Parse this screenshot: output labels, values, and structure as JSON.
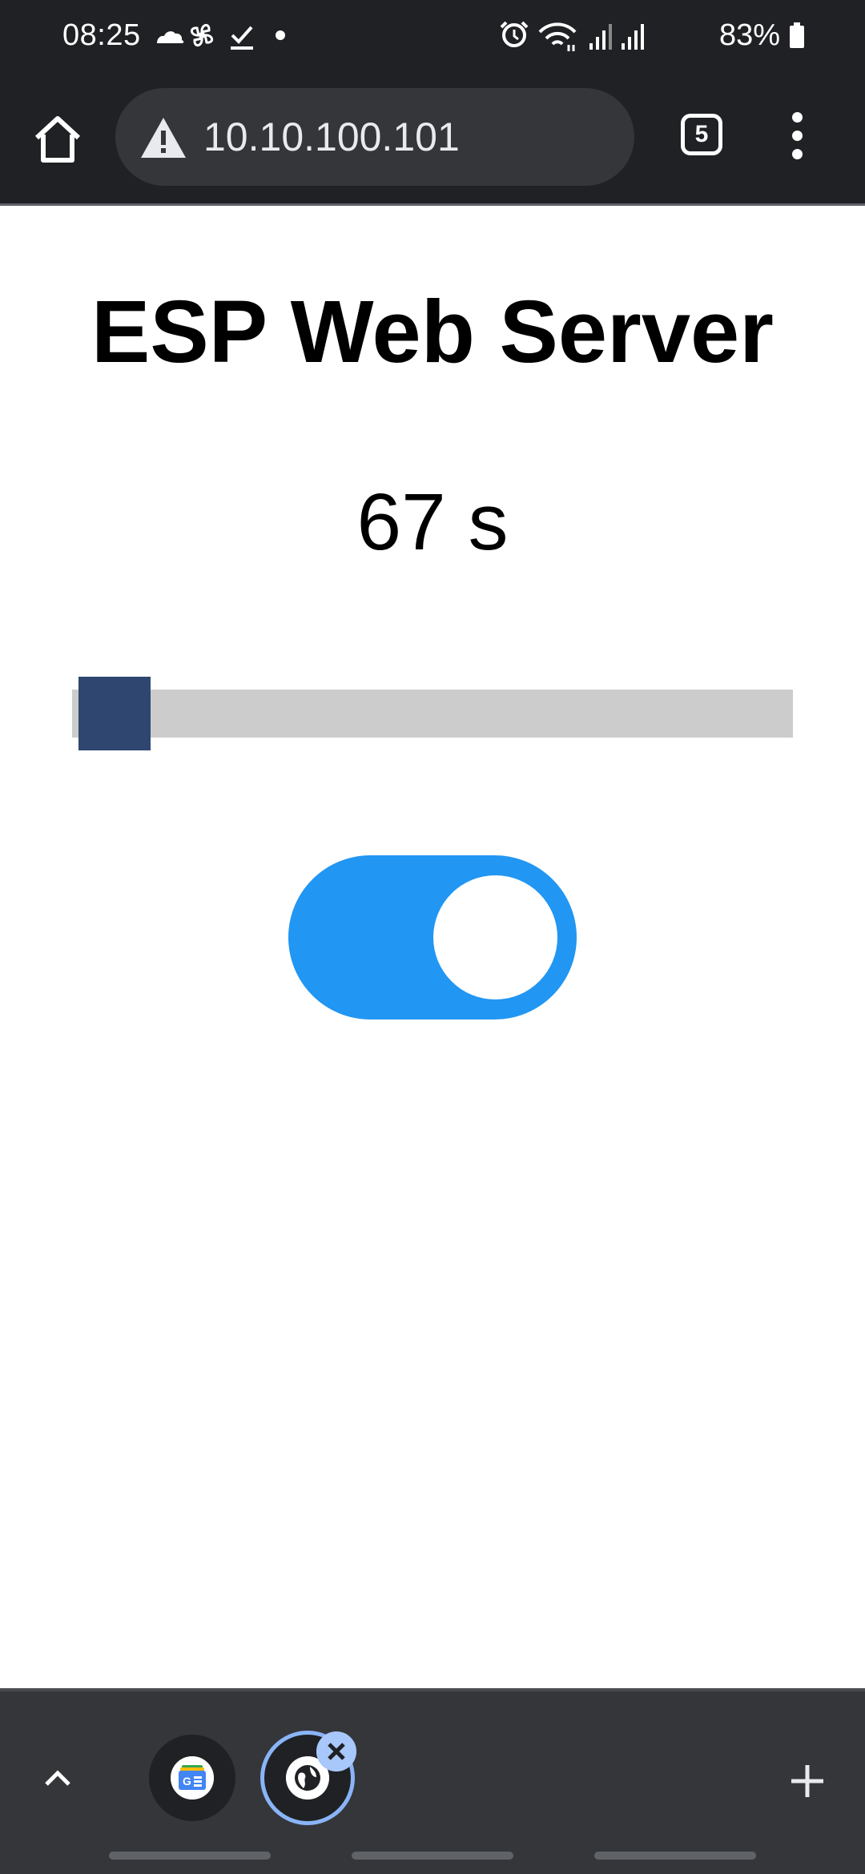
{
  "status_bar": {
    "time": "08:25",
    "battery": "83%",
    "left_icons": [
      "cloud-icon",
      "pinwheel-icon",
      "checkmark-icon",
      "dot-icon"
    ],
    "right_icons": [
      "alarm-icon",
      "wifi-icon",
      "signal-icon",
      "signal-icon",
      "battery-icon"
    ]
  },
  "toolbar": {
    "url": "10.10.100.101",
    "tab_count": "5",
    "home_icon": "home-icon",
    "security_icon": "warning-icon",
    "menu_icon": "more-vert-icon"
  },
  "page": {
    "title": "ESP Web Server",
    "timer_text": "67 s",
    "slider": {
      "value": 0,
      "min": 0,
      "max": 100
    },
    "toggle": {
      "checked": true
    },
    "colors": {
      "slider_track": "#cccccc",
      "slider_thumb": "#2e4670",
      "toggle_on": "#2196f3"
    }
  },
  "tab_strip": {
    "expand_icon": "chevron-up-icon",
    "tabs": [
      {
        "favicon": "google-news-icon",
        "selected": false
      },
      {
        "favicon": "globe-icon",
        "selected": true
      }
    ],
    "close_icon": "close-icon",
    "new_tab_icon": "plus-icon"
  }
}
